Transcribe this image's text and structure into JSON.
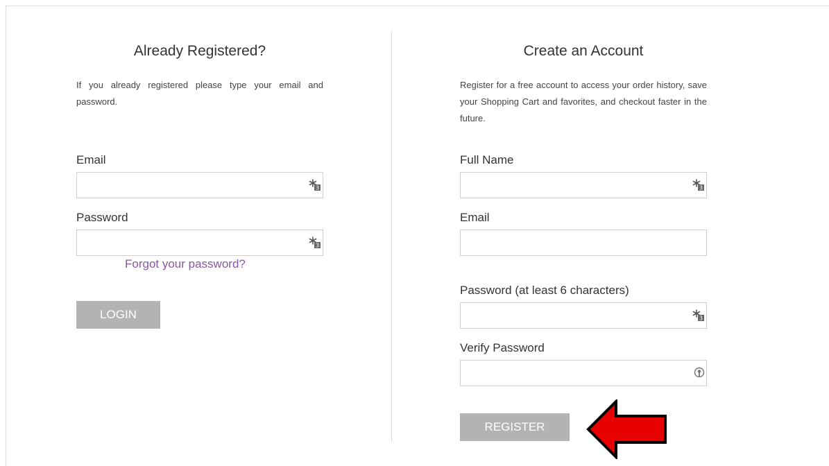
{
  "login": {
    "title": "Already Registered?",
    "description": "If you already registered please type your email and password.",
    "email_label": "Email",
    "email_value": "",
    "password_label": "Password",
    "password_value": "",
    "forgot_link": "Forgot your password?",
    "login_button": "LOGIN"
  },
  "register": {
    "title": "Create an Account",
    "description": "Register for a free account to access your order history, save your Shopping Cart and favorites, and checkout faster in the future.",
    "fullname_label": "Full Name",
    "fullname_value": "",
    "email_label": "Email",
    "email_value": "",
    "password_label": "Password (at least 6 characters)",
    "password_value": "",
    "verify_label": "Verify Password",
    "verify_value": "",
    "register_button": "REGISTER"
  },
  "icons": {
    "field_icon": "password-manager-icon",
    "verify_field_icon": "key-icon",
    "annotation": "red-arrow-icon"
  },
  "colors": {
    "button": "#b3b3b3",
    "link": "#8b56a6",
    "arrow": "#e60000"
  }
}
